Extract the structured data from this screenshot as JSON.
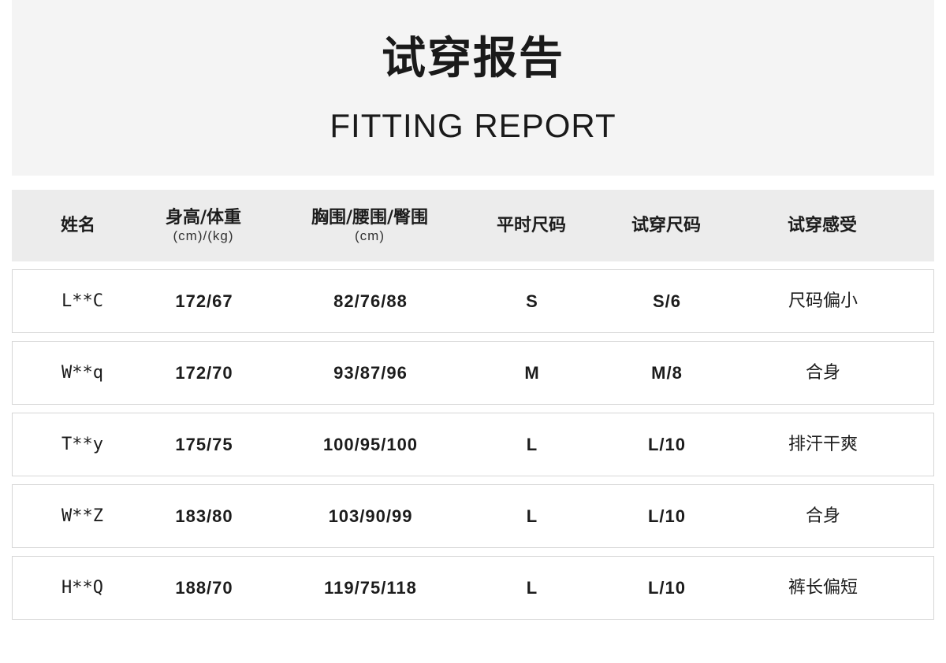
{
  "header": {
    "title_cn": "试穿报告",
    "title_en": "FITTING REPORT"
  },
  "table": {
    "columns": [
      {
        "label": "姓名",
        "sub": ""
      },
      {
        "label": "身高/体重",
        "sub": "(cm)/(kg)"
      },
      {
        "label": "胸围/腰围/臀围",
        "sub": "(cm)"
      },
      {
        "label": "平时尺码",
        "sub": ""
      },
      {
        "label": "试穿尺码",
        "sub": ""
      },
      {
        "label": "试穿感受",
        "sub": ""
      }
    ],
    "rows": [
      {
        "name": "L**C",
        "height_weight": "172/67",
        "measurements": "82/76/88",
        "usual_size": "S",
        "fit_size": "S/6",
        "feeling": "尺码偏小"
      },
      {
        "name": "W**q",
        "height_weight": "172/70",
        "measurements": "93/87/96",
        "usual_size": "M",
        "fit_size": "M/8",
        "feeling": "合身"
      },
      {
        "name": "T**y",
        "height_weight": "175/75",
        "measurements": "100/95/100",
        "usual_size": "L",
        "fit_size": "L/10",
        "feeling": "排汗干爽"
      },
      {
        "name": "W**Z",
        "height_weight": "183/80",
        "measurements": "103/90/99",
        "usual_size": "L",
        "fit_size": "L/10",
        "feeling": "合身"
      },
      {
        "name": "H**Q",
        "height_weight": "188/70",
        "measurements": "119/75/118",
        "usual_size": "L",
        "fit_size": "L/10",
        "feeling": "裤长偏短"
      }
    ]
  }
}
